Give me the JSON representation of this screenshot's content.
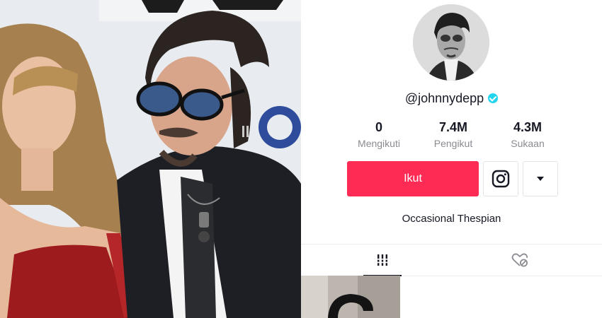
{
  "profile": {
    "username": "@johnnydepp",
    "verified": true,
    "stats": [
      {
        "value": "0",
        "label": "Mengikuti"
      },
      {
        "value": "7.4M",
        "label": "Pengikut"
      },
      {
        "value": "4.3M",
        "label": "Sukaan"
      }
    ],
    "follow_label": "Ikut",
    "bio": "Occasional Thespian"
  },
  "icons": {
    "instagram": "instagram-icon",
    "dropdown": "caret-down-icon",
    "videos_tab": "grid-icon",
    "liked_tab": "liked-heart-icon"
  },
  "colors": {
    "accent": "#fe2c55",
    "verified": "#20d5ec",
    "text": "#161823",
    "muted": "#8a8b91"
  }
}
